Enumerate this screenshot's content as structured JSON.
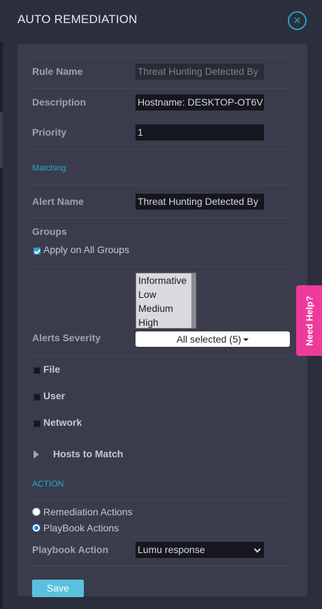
{
  "header": {
    "title": "AUTO REMEDIATION",
    "close_icon": "×"
  },
  "form": {
    "rule_name": {
      "label": "Rule Name",
      "value": "Threat Hunting Detected By"
    },
    "description": {
      "label": "Description",
      "value": "Hostname: DESKTOP-OT6V"
    },
    "priority": {
      "label": "Priority",
      "value": "1"
    },
    "matching_label": "Matching",
    "alert_name": {
      "label": "Alert Name",
      "value": "Threat Hunting Detected By"
    },
    "groups_label": "Groups",
    "apply_all_groups": {
      "label": "Apply on All Groups",
      "checked": true
    },
    "severity_options": [
      "Informative",
      "Low",
      "Medium",
      "High"
    ],
    "alerts_severity": {
      "label": "Alerts Severity",
      "value": "All selected (5)"
    },
    "file_label": "File",
    "user_label": "User",
    "network_label": "Network",
    "hosts_to_match_label": "Hosts to Match",
    "action_label": "ACTION",
    "remediation_actions": {
      "label": "Remediation Actions",
      "selected": false
    },
    "playbook_actions": {
      "label": "PlayBook Actions",
      "selected": true
    },
    "playbook_action": {
      "label": "Playbook Action",
      "value": "Lumu response"
    },
    "save_label": "Save"
  },
  "help": {
    "label": "Need Help?"
  },
  "colors": {
    "accent": "#2aa0c8",
    "help": "#ee3a9b",
    "save": "#5bc0de"
  }
}
